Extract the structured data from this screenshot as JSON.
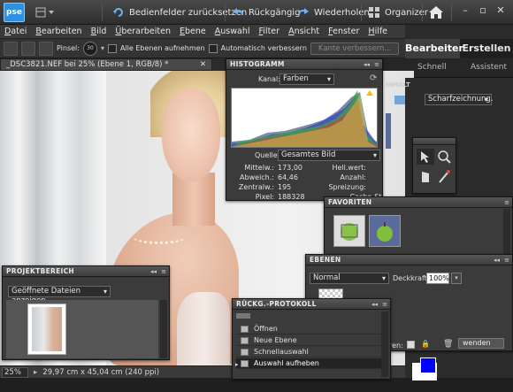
{
  "app": {
    "logo_text": "pse"
  },
  "topbar": {
    "reset_panels": "Bedienfelder zurücksetzen",
    "undo": "Rückgängig",
    "redo": "Wiederholen",
    "organizer": "Organizer"
  },
  "menu": [
    "Datei",
    "Bearbeiten",
    "Bild",
    "Überarbeiten",
    "Ebene",
    "Auswahl",
    "Filter",
    "Ansicht",
    "Fenster",
    "Hilfe"
  ],
  "options": {
    "brush_label": "Pinsel:",
    "brush_size": "30",
    "sample_all_layers": "Alle Ebenen aufnehmen",
    "auto_enhance": "Automatisch verbessern",
    "refine_edge": "Kante verbessern..."
  },
  "modes": {
    "edit": "Bearbeiten",
    "create": "Erstellen",
    "quick": "Schnell",
    "assistant": "Assistent"
  },
  "document": {
    "tab_title": "_DSC3821.NEF bei 25% (Ebene 1, RGB/8) *",
    "zoom": "25%",
    "dimensions": "29,97 cm x 45,04 cm (240 ppi)"
  },
  "histogram": {
    "title": "HISTOGRAMM",
    "channel_label": "Kanal:",
    "channel_value": "Farben",
    "source_label": "Quelle:",
    "source_value": "Gesamtes Bild",
    "stats_left": [
      {
        "label": "Mittelw.:",
        "value": "173,00"
      },
      {
        "label": "Abweich.:",
        "value": "64,46"
      },
      {
        "label": "Zentralw.:",
        "value": "195"
      },
      {
        "label": "Pixel:",
        "value": "188328"
      }
    ],
    "stats_right": [
      "Hell.wert:",
      "Anzahl:",
      "Spreizung:",
      "Cache-St."
    ]
  },
  "content_panel": {
    "title_fragment": "INHALT",
    "filter_value": "Scharfzeichnung."
  },
  "favorites": {
    "title": "FAVORITEN"
  },
  "layers": {
    "title": "EBENEN",
    "blend_mode": "Normal",
    "opacity_label": "Deckkraft:",
    "opacity_value": "100%",
    "button_fragment": "wenden",
    "label_fragment": "ren:"
  },
  "projects": {
    "title": "PROJEKTBEREICH",
    "dropdown": "Geöffnete Dateien anzeigen"
  },
  "undo_history": {
    "title": "RÜCKG.-PROTOKOLL",
    "items": [
      "Öffnen",
      "Neue Ebene",
      "Schnellauswahl",
      "Auswahl aufheben"
    ]
  },
  "colors": {
    "accent": "#2f8fe0",
    "foreground_swatch": "#0000ff",
    "panel_bg": "#3b3b3b"
  }
}
